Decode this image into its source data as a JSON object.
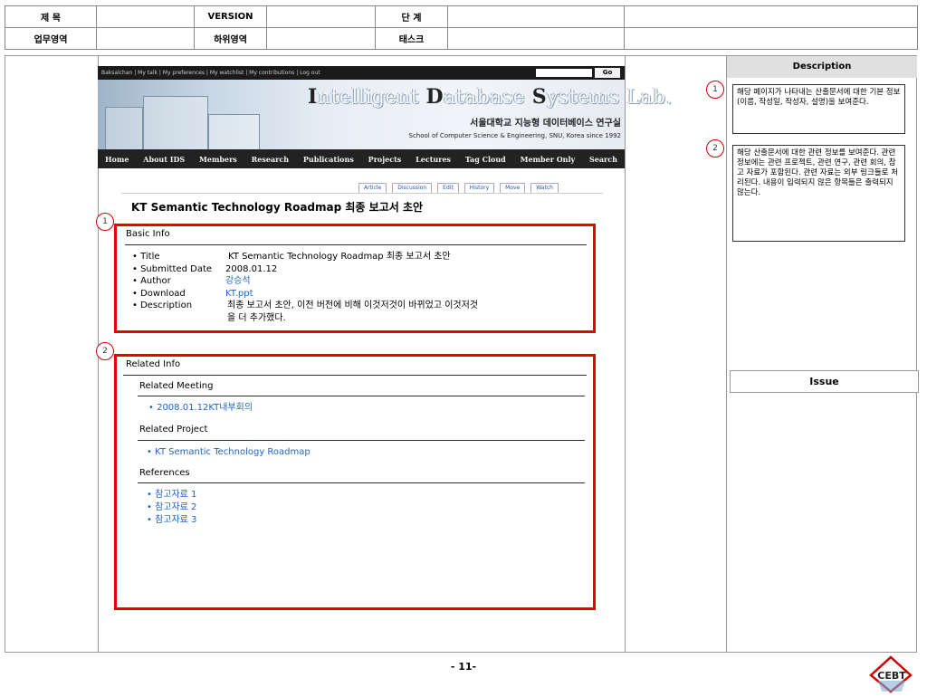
{
  "header": {
    "row1": {
      "title_label": "제 목",
      "title_value": "",
      "version_label": "VERSION",
      "version_value": "",
      "stage_label": "단 계",
      "stage_value": ""
    },
    "row2": {
      "area_label": "업무영역",
      "area_value": "",
      "subarea_label": "하위영역",
      "subarea_value": "",
      "task_label": "태스크",
      "task_value": ""
    }
  },
  "wiki": {
    "topbar": "Baksalchan  |  My talk  |  My preferences  |  My watchlist  |  My contributions  |  Log out",
    "go_label": "Go",
    "banner": {
      "t1": "I",
      "t1rest": "ntelligent ",
      "t2": "D",
      "t2rest": "atabase ",
      "t3": "S",
      "t3rest": "ystems Lab.",
      "korean": "서울대학교 지능형 데이터베이스 연구실",
      "english": "School of Computer Science & Engineering, SNU, Korea since 1992"
    },
    "nav": [
      "Home",
      "About IDS",
      "Members",
      "Research",
      "Publications",
      "Projects",
      "Lectures",
      "Tag Cloud",
      "Member Only",
      "Search"
    ],
    "tabs": [
      "Article",
      "Discussion",
      "Edit",
      "History",
      "Move",
      "Watch"
    ],
    "page_title": "KT Semantic Technology Roadmap 최종 보고서 초안",
    "basic": {
      "heading": "Basic Info",
      "rows": [
        {
          "label": "• Title",
          "value": "KT Semantic Technology Roadmap 최종 보고서 초안"
        },
        {
          "label": "• Submitted Date",
          "value": "2008.01.12"
        },
        {
          "label": "• Author",
          "value": "강승석"
        },
        {
          "label": "• Download",
          "value": "KT.ppt"
        },
        {
          "label": "• Description",
          "value": "최종 보고서 초안, 이전 버전에 비해 이것저것이 바뀌었고 이것저것",
          "value2": "을 더 추가했다."
        }
      ]
    },
    "related": {
      "heading": "Related Info",
      "meeting_heading": "Related Meeting",
      "meeting_item": "• 2008.01.12KT내부회의",
      "project_heading": "Related Project",
      "project_item": "• KT Semantic Technology Roadmap",
      "references_heading": "References",
      "references": [
        "• 참고자료 1",
        "• 참고자료 2",
        "• 참고자료 3"
      ]
    }
  },
  "callouts": {
    "one": "1",
    "two": "2"
  },
  "right_panel": {
    "description_heading": "Description",
    "desc1": "해당 페이지가 나타내는 산출문서에 대한 기본 정보(이름, 작성일, 작성자, 설명)을 보여준다.",
    "desc2": "해당 산출문서에 대한 관련 정보를 보여준다. 관련 정보에는 관련 프로젝트, 관련 연구, 관련 회의, 참고 자료가 포함된다. 관련 자료는 외부 링크들로 처리된다. 내용이 입력되지 않은 항목들은 출력되지 않는다.",
    "issue_heading": "Issue"
  },
  "footer": {
    "page": "- 11-",
    "logo_text": "CEBT"
  },
  "colors": {
    "highlight": "#e60000",
    "link": "#2266bb",
    "nav_bg": "#222222"
  }
}
